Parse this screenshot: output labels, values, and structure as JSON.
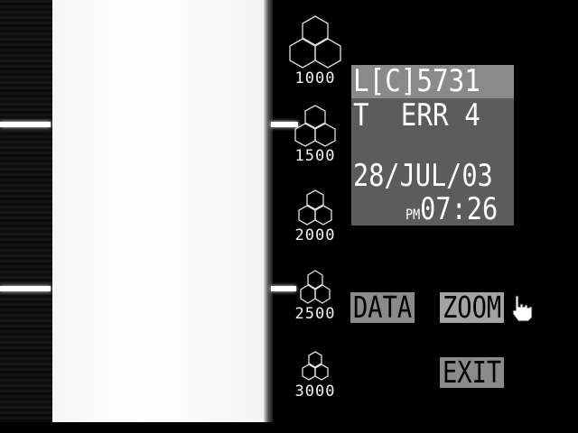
{
  "scale": {
    "labels": [
      "1000",
      "1500",
      "2000",
      "2500",
      "3000"
    ]
  },
  "info": {
    "line1": "L[C]5731",
    "line2": "T  ERR 4",
    "date": "28/JUL/03",
    "ampm": "PM",
    "time": "07:26"
  },
  "menu": {
    "data_label": "DATA",
    "zoom_label": "ZOOM",
    "exit_label": "EXIT"
  },
  "icons": {
    "scale_item": "hexagon-cluster-icon",
    "cursor": "hand-pointer-icon"
  },
  "colors": {
    "panel": "#5c5c5c",
    "button": "#8a8a8a",
    "text": "#ffffff"
  }
}
